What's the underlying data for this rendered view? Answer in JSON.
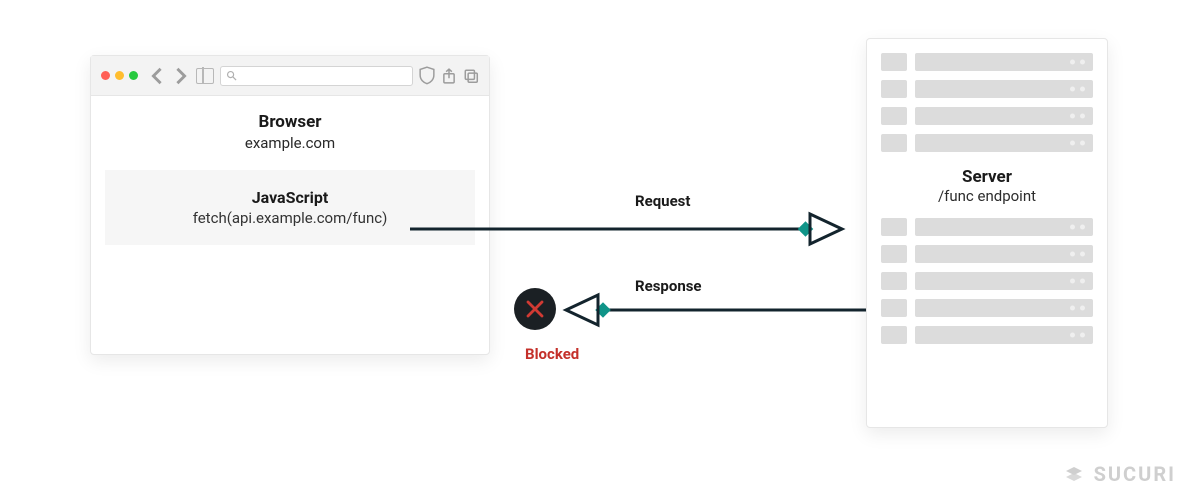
{
  "browser": {
    "title": "Browser",
    "domain": "example.com",
    "js_title": "JavaScript",
    "js_code": "fetch(api.example.com/func)"
  },
  "server": {
    "title": "Server",
    "endpoint": "/func endpoint"
  },
  "arrows": {
    "request_label": "Request",
    "response_label": "Response",
    "blocked_label": "Blocked"
  },
  "brand": {
    "name": "SUCURI"
  },
  "colors": {
    "line": "#13242d",
    "accent": "#0f7f79",
    "blocked": "#c4302a"
  }
}
